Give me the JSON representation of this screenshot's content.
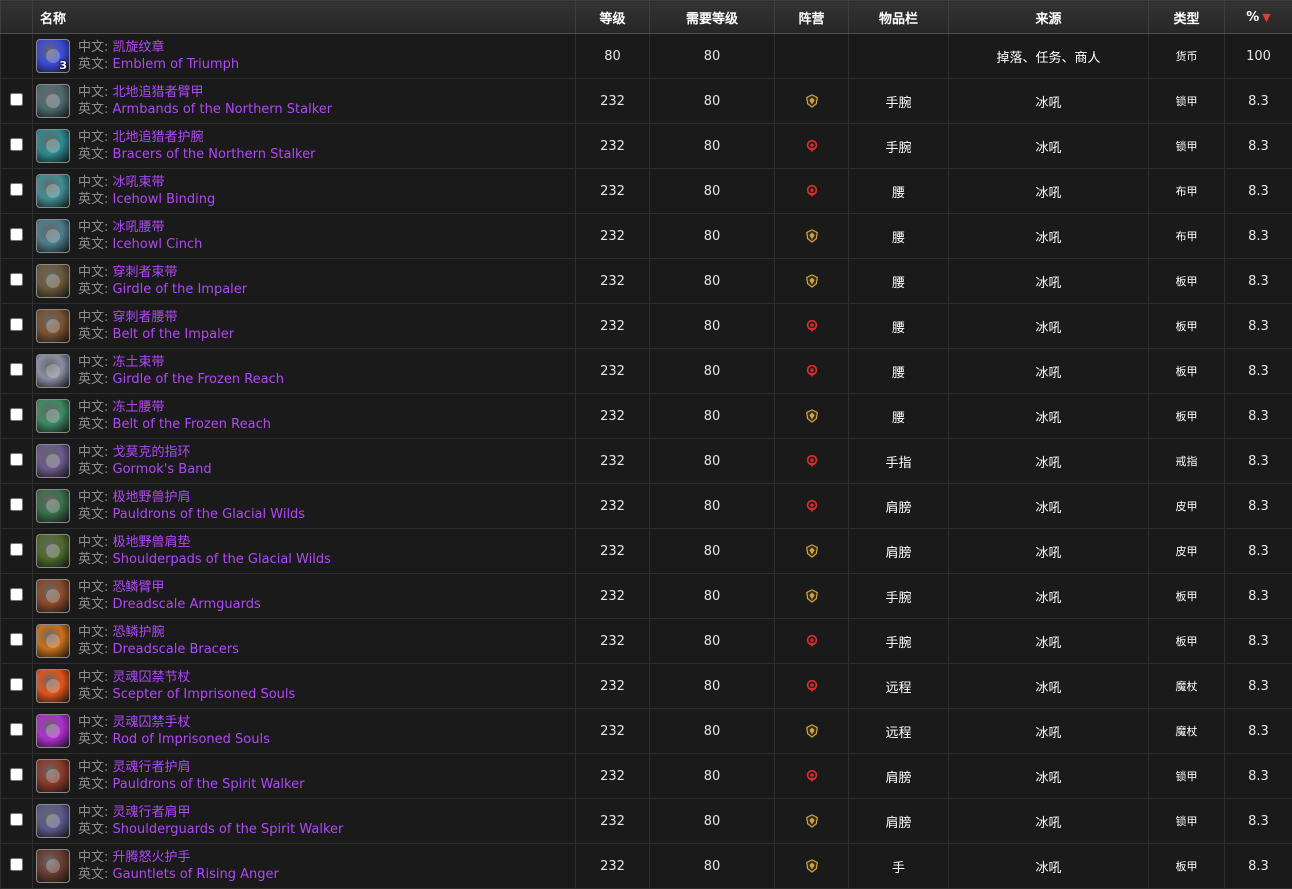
{
  "header": {
    "name": "名称",
    "level": "等级",
    "req_level": "需要等级",
    "faction": "阵营",
    "slot": "物品栏",
    "source": "来源",
    "type": "类型",
    "pct": "%"
  },
  "labels": {
    "cn": "中文:",
    "en": "英文:"
  },
  "colors": {
    "item_purple": "#b048f8",
    "alliance": "#c9a44a",
    "horde": "#d92c2c"
  },
  "items": [
    {
      "cn": "凯旋纹章",
      "en": "Emblem of Triumph",
      "level": "80",
      "req": "80",
      "faction": "",
      "slot": "",
      "source": "掉落、任务、商人",
      "type": "货币",
      "pct": "100",
      "icon": "emblem-icon",
      "icolor": "#3b4ad8",
      "stack": "3",
      "checkbox": false
    },
    {
      "cn": "北地追猎者臂甲",
      "en": "Armbands of the Northern Stalker",
      "level": "232",
      "req": "80",
      "faction": "alliance",
      "slot": "手腕",
      "source": "冰吼",
      "type": "锁甲",
      "pct": "8.3",
      "icon": "bracer-icon",
      "icolor": "#4f6b70",
      "stack": "",
      "checkbox": true
    },
    {
      "cn": "北地追猎者护腕",
      "en": "Bracers of the Northern Stalker",
      "level": "232",
      "req": "80",
      "faction": "horde",
      "slot": "手腕",
      "source": "冰吼",
      "type": "锁甲",
      "pct": "8.3",
      "icon": "bracer-icon",
      "icolor": "#2d8a8f",
      "stack": "",
      "checkbox": true
    },
    {
      "cn": "冰吼束带",
      "en": "Icehowl Binding",
      "level": "232",
      "req": "80",
      "faction": "horde",
      "slot": "腰",
      "source": "冰吼",
      "type": "布甲",
      "pct": "8.3",
      "icon": "belt-icon",
      "icolor": "#3f8e92",
      "stack": "",
      "checkbox": true
    },
    {
      "cn": "冰吼腰带",
      "en": "Icehowl Cinch",
      "level": "232",
      "req": "80",
      "faction": "alliance",
      "slot": "腰",
      "source": "冰吼",
      "type": "布甲",
      "pct": "8.3",
      "icon": "belt-icon",
      "icolor": "#4c7c8c",
      "stack": "",
      "checkbox": true
    },
    {
      "cn": "穿刺者束带",
      "en": "Girdle of the Impaler",
      "level": "232",
      "req": "80",
      "faction": "alliance",
      "slot": "腰",
      "source": "冰吼",
      "type": "板甲",
      "pct": "8.3",
      "icon": "belt-icon",
      "icolor": "#6b5a3a",
      "stack": "",
      "checkbox": true
    },
    {
      "cn": "穿刺者腰带",
      "en": "Belt of the Impaler",
      "level": "232",
      "req": "80",
      "faction": "horde",
      "slot": "腰",
      "source": "冰吼",
      "type": "板甲",
      "pct": "8.3",
      "icon": "belt-icon",
      "icolor": "#7a5230",
      "stack": "",
      "checkbox": true
    },
    {
      "cn": "冻土束带",
      "en": "Girdle of the Frozen Reach",
      "level": "232",
      "req": "80",
      "faction": "horde",
      "slot": "腰",
      "source": "冰吼",
      "type": "板甲",
      "pct": "8.3",
      "icon": "belt-icon",
      "icolor": "#8a8fa4",
      "stack": "",
      "checkbox": true
    },
    {
      "cn": "冻土腰带",
      "en": "Belt of the Frozen Reach",
      "level": "232",
      "req": "80",
      "faction": "alliance",
      "slot": "腰",
      "source": "冰吼",
      "type": "板甲",
      "pct": "8.3",
      "icon": "belt-icon",
      "icolor": "#3d8a63",
      "stack": "",
      "checkbox": true
    },
    {
      "cn": "戈莫克的指环",
      "en": "Gormok's Band",
      "level": "232",
      "req": "80",
      "faction": "horde",
      "slot": "手指",
      "source": "冰吼",
      "type": "戒指",
      "pct": "8.3",
      "icon": "ring-icon",
      "icolor": "#6b5a8c",
      "stack": "",
      "checkbox": true
    },
    {
      "cn": "极地野兽护肩",
      "en": "Pauldrons of the Glacial Wilds",
      "level": "232",
      "req": "80",
      "faction": "horde",
      "slot": "肩膀",
      "source": "冰吼",
      "type": "皮甲",
      "pct": "8.3",
      "icon": "shoulder-icon",
      "icolor": "#3a6e4a",
      "stack": "",
      "checkbox": true
    },
    {
      "cn": "极地野兽肩垫",
      "en": "Shoulderpads of the Glacial Wilds",
      "level": "232",
      "req": "80",
      "faction": "alliance",
      "slot": "肩膀",
      "source": "冰吼",
      "type": "皮甲",
      "pct": "8.3",
      "icon": "shoulder-icon",
      "icolor": "#4e6a2c",
      "stack": "",
      "checkbox": true
    },
    {
      "cn": "恐鳞臂甲",
      "en": "Dreadscale Armguards",
      "level": "232",
      "req": "80",
      "faction": "alliance",
      "slot": "手腕",
      "source": "冰吼",
      "type": "板甲",
      "pct": "8.3",
      "icon": "bracer-icon",
      "icolor": "#8a4a2a",
      "stack": "",
      "checkbox": true
    },
    {
      "cn": "恐鳞护腕",
      "en": "Dreadscale Bracers",
      "level": "232",
      "req": "80",
      "faction": "horde",
      "slot": "手腕",
      "source": "冰吼",
      "type": "板甲",
      "pct": "8.3",
      "icon": "bracer-icon",
      "icolor": "#c9701a",
      "stack": "",
      "checkbox": true
    },
    {
      "cn": "灵魂囚禁节杖",
      "en": "Scepter of Imprisoned Souls",
      "level": "232",
      "req": "80",
      "faction": "horde",
      "slot": "远程",
      "source": "冰吼",
      "type": "魔杖",
      "pct": "8.3",
      "icon": "wand-icon",
      "icolor": "#e0551a",
      "stack": "",
      "checkbox": true
    },
    {
      "cn": "灵魂囚禁手杖",
      "en": "Rod of Imprisoned Souls",
      "level": "232",
      "req": "80",
      "faction": "alliance",
      "slot": "远程",
      "source": "冰吼",
      "type": "魔杖",
      "pct": "8.3",
      "icon": "wand-icon",
      "icolor": "#b02fd0",
      "stack": "",
      "checkbox": true
    },
    {
      "cn": "灵魂行者护肩",
      "en": "Pauldrons of the Spirit Walker",
      "level": "232",
      "req": "80",
      "faction": "horde",
      "slot": "肩膀",
      "source": "冰吼",
      "type": "锁甲",
      "pct": "8.3",
      "icon": "shoulder-icon",
      "icolor": "#8a3a2a",
      "stack": "",
      "checkbox": true
    },
    {
      "cn": "灵魂行者肩甲",
      "en": "Shoulderguards of the Spirit Walker",
      "level": "232",
      "req": "80",
      "faction": "alliance",
      "slot": "肩膀",
      "source": "冰吼",
      "type": "锁甲",
      "pct": "8.3",
      "icon": "shoulder-icon",
      "icolor": "#5a5a8c",
      "stack": "",
      "checkbox": true
    },
    {
      "cn": "升腾怒火护手",
      "en": "Gauntlets of Rising Anger",
      "level": "232",
      "req": "80",
      "faction": "alliance",
      "slot": "手",
      "source": "冰吼",
      "type": "板甲",
      "pct": "8.3",
      "icon": "gauntlet-icon",
      "icolor": "#6a3a30",
      "stack": "",
      "checkbox": true
    }
  ]
}
